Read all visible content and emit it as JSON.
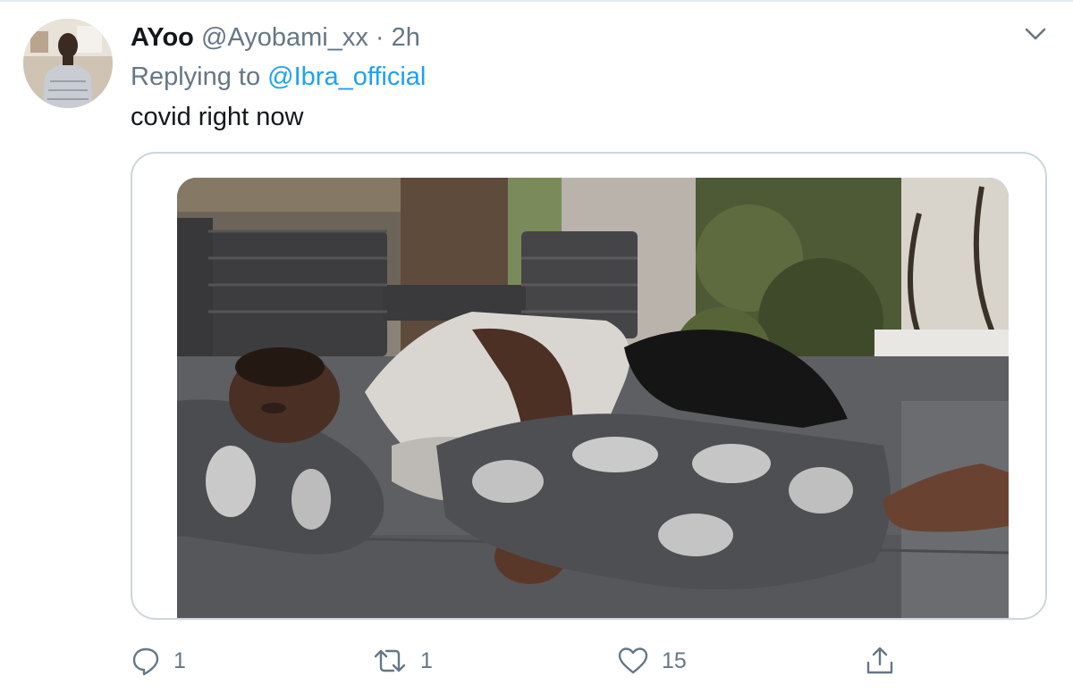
{
  "tweet": {
    "display_name": "AYoo",
    "handle": "@Ayobami_xx",
    "separator": "·",
    "time": "2h",
    "reply_prefix": "Replying to",
    "reply_to": "@Ibra_official",
    "text": "covid right now"
  },
  "actions": {
    "reply_count": "1",
    "retweet_count": "1",
    "like_count": "15"
  },
  "icons": {
    "reply": "reply-bubble-icon",
    "retweet": "retweet-icon",
    "like": "heart-icon",
    "share": "share-icon",
    "more": "chevron-down-icon"
  },
  "colors": {
    "link": "#1da1f2",
    "secondary_text": "#657786",
    "card_border": "#ccd6dd"
  }
}
